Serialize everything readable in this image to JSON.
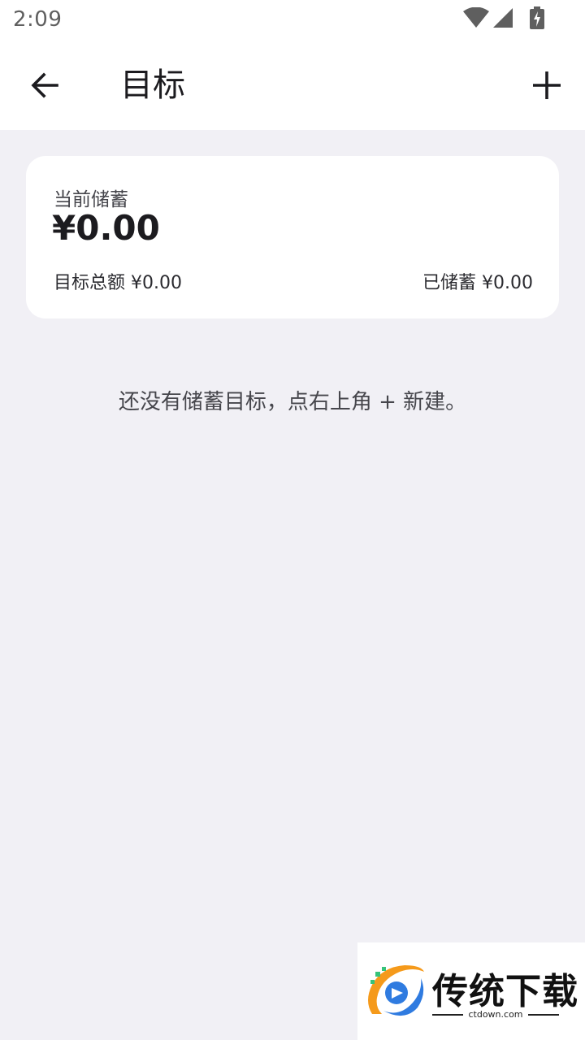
{
  "status_bar": {
    "time": "2:09",
    "icons": [
      "wifi-icon",
      "cell-signal-icon",
      "battery-charging-icon"
    ]
  },
  "app_bar": {
    "title": "目标",
    "back_icon": "arrow-back-icon",
    "add_icon": "plus-icon"
  },
  "summary": {
    "label": "当前储蓄",
    "amount": "¥0.00",
    "target_total_label": "目标总额",
    "target_total_value": "¥0.00",
    "saved_label": "已储蓄",
    "saved_value": "¥0.00"
  },
  "empty_state": {
    "message": "还没有储蓄目标，点右上角 + 新建。"
  },
  "watermark": {
    "text": "传统下载",
    "url": "ctdown.com",
    "colors": {
      "orange": "#f59a1b",
      "blue": "#2f7be0",
      "green": "#36c37a"
    }
  }
}
